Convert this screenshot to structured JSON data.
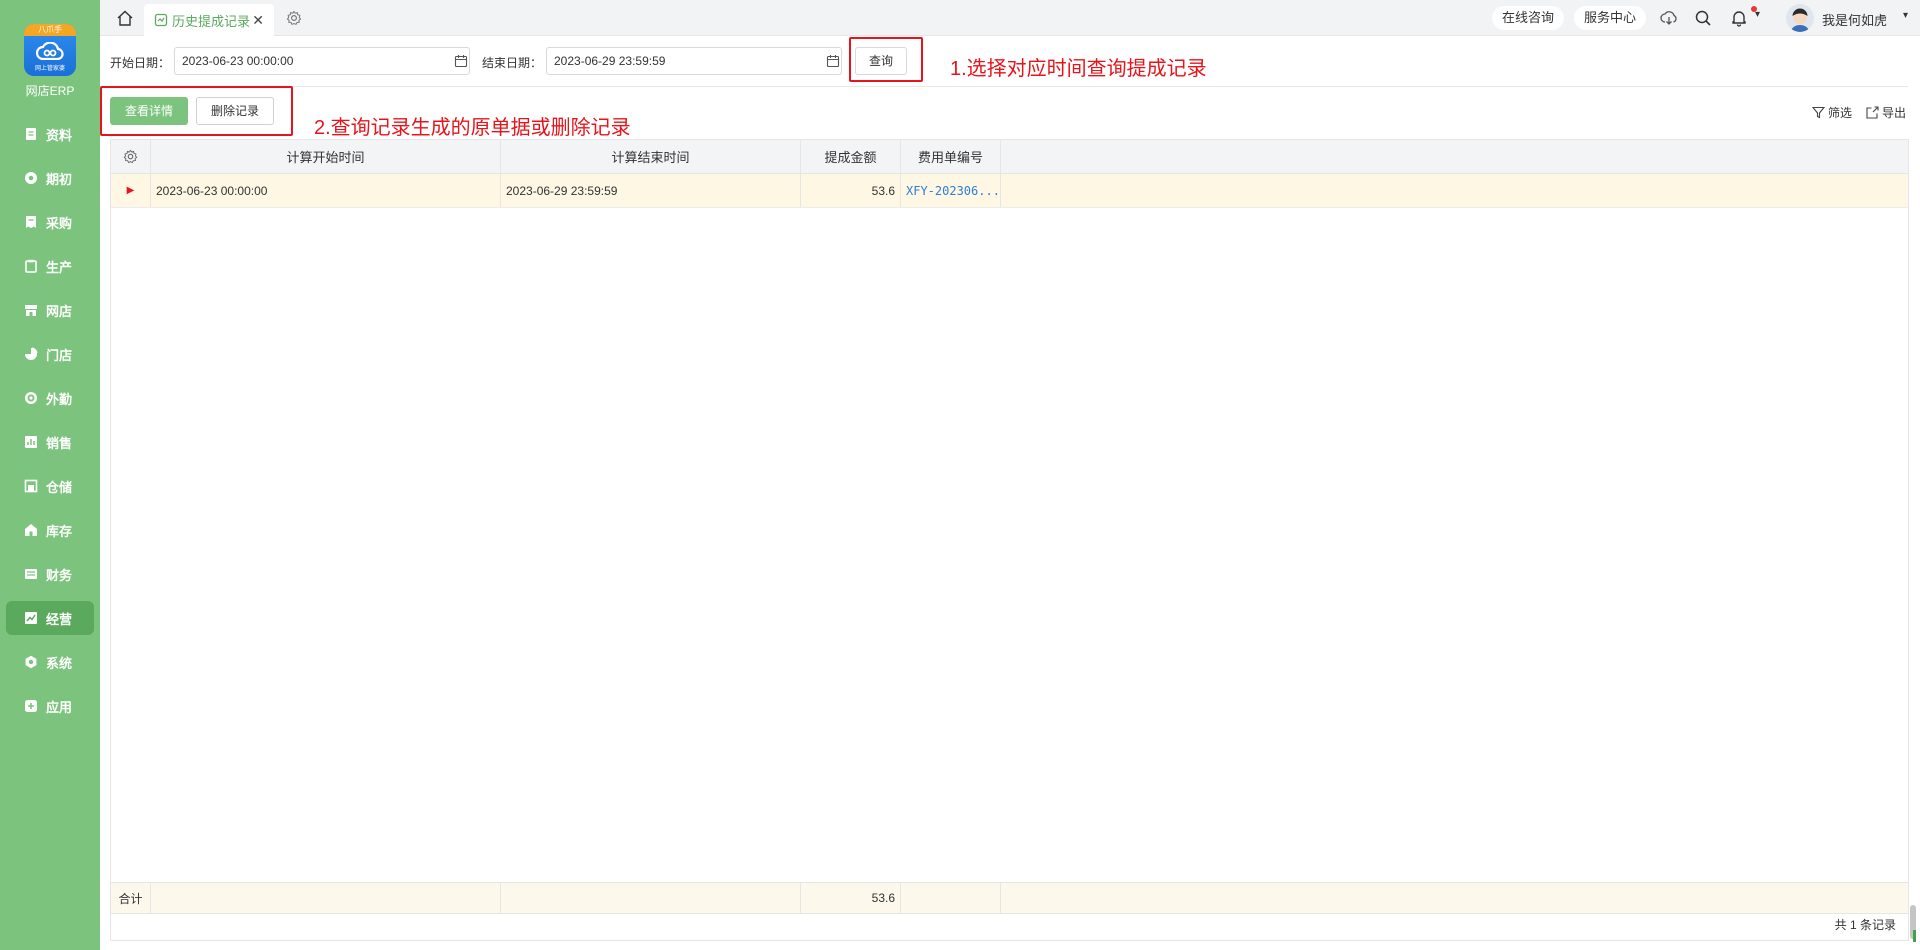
{
  "app": {
    "logo_ribbon": "八爪手",
    "logo_sub": "网上管家婆",
    "name": "网店ERP"
  },
  "sidebar": {
    "items": [
      {
        "label": "资料",
        "icon": "document-icon"
      },
      {
        "label": "期初",
        "icon": "clock-icon"
      },
      {
        "label": "采购",
        "icon": "receipt-icon"
      },
      {
        "label": "生产",
        "icon": "clipboard-icon"
      },
      {
        "label": "网店",
        "icon": "store-icon"
      },
      {
        "label": "门店",
        "icon": "pie-icon"
      },
      {
        "label": "外勤",
        "icon": "target-icon"
      },
      {
        "label": "销售",
        "icon": "bar-chart-icon"
      },
      {
        "label": "仓储",
        "icon": "warehouse-icon"
      },
      {
        "label": "库存",
        "icon": "house-icon"
      },
      {
        "label": "财务",
        "icon": "wallet-icon"
      },
      {
        "label": "经营",
        "icon": "trend-icon"
      },
      {
        "label": "系统",
        "icon": "settings-icon"
      },
      {
        "label": "应用",
        "icon": "plus-icon"
      }
    ],
    "active": "经营"
  },
  "topbar": {
    "tab_label": "历史提成记录",
    "tab_close": "✕",
    "online_consult": "在线咨询",
    "service_center": "服务中心",
    "username": "我是何如虎",
    "user_caret": "▾",
    "notif_caret": "▾"
  },
  "filter": {
    "start_label": "开始日期：",
    "start_value": "2023-06-23 00:00:00",
    "end_label": "结束日期：",
    "end_value": "2023-06-29 23:59:59",
    "query_label": "查询"
  },
  "annotations": {
    "note1": "1.选择对应时间查询提成记录",
    "note2": "2.查询记录生成的原单据或删除记录"
  },
  "actions": {
    "detail_label": "查看详情",
    "delete_label": "删除记录",
    "filter_label": "筛选",
    "export_label": "导出"
  },
  "grid": {
    "columns": [
      "计算开始时间",
      "计算结束时间",
      "提成金额",
      "费用单编号"
    ],
    "rows": [
      {
        "marker": "▶",
        "start": "2023-06-23 00:00:00",
        "end": "2023-06-29 23:59:59",
        "amount": "53.6",
        "doc_no": "XFY-202306..."
      }
    ],
    "footer": {
      "label": "合计",
      "amount_total": "53.6"
    },
    "record_count": "共 1 条记录"
  }
}
